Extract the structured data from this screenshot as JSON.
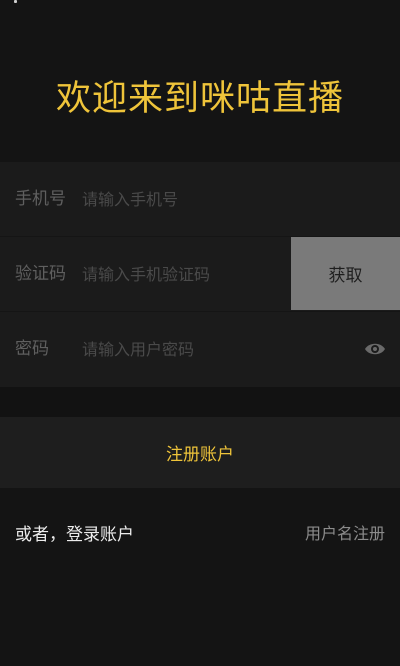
{
  "header": {
    "welcome_title": "欢迎来到咪咕直播"
  },
  "form": {
    "phone": {
      "label": "手机号",
      "placeholder": "请输入手机号",
      "value": ""
    },
    "code": {
      "label": "验证码",
      "placeholder": "请输入手机验证码",
      "value": "",
      "get_button_label": "获取"
    },
    "password": {
      "label": "密码",
      "placeholder": "请输入用户密码",
      "value": "",
      "toggle_icon": "eye-icon"
    }
  },
  "actions": {
    "register_label": "注册账户",
    "login_link": "或者，登录账户",
    "username_register_link": "用户名注册"
  },
  "colors": {
    "accent": "#efc43a",
    "background": "#141414",
    "form_background": "#1b1b1b",
    "button_gray": "#7a7a7a"
  }
}
